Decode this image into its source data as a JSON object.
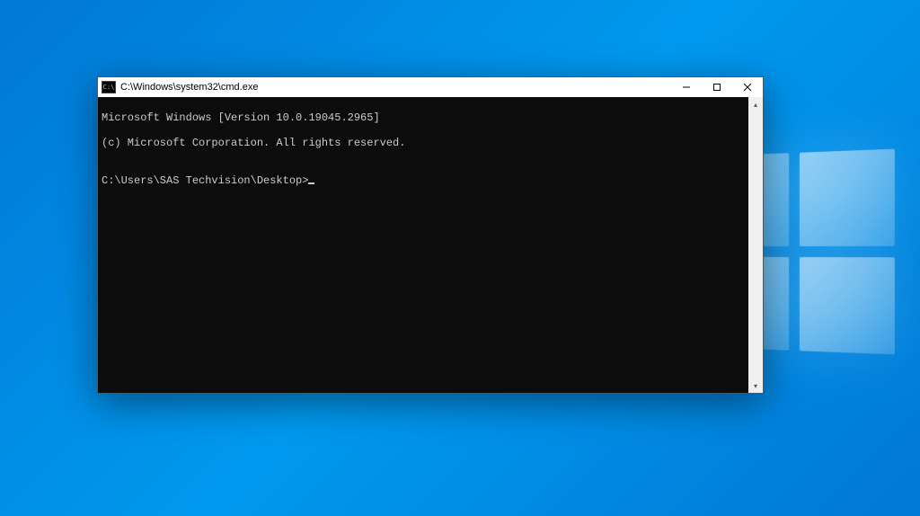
{
  "window": {
    "title": "C:\\Windows\\system32\\cmd.exe",
    "icon_label": "C:\\"
  },
  "terminal": {
    "line1": "Microsoft Windows [Version 10.0.19045.2965]",
    "line2": "(c) Microsoft Corporation. All rights reserved.",
    "blank": "",
    "prompt": "C:\\Users\\SAS Techvision\\Desktop>"
  },
  "controls": {
    "minimize": "minimize",
    "maximize": "maximize",
    "close": "close"
  }
}
